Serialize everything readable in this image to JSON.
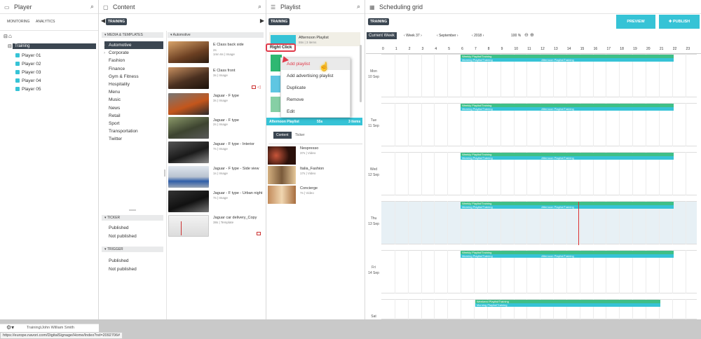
{
  "player_pane": {
    "title": "Player",
    "tabs": [
      "MONITORING",
      "ANALYTICS"
    ],
    "tree_root_icon": "home-icon",
    "group": "Training",
    "players": [
      "Player 01",
      "Player 02",
      "Player 03",
      "Player 04",
      "Player 05"
    ],
    "footer_user": "Training\\John William Smith",
    "status_url": "https://europe.navori.com/DigitalSignage/Home/Index?rel=2092706#"
  },
  "content_pane": {
    "title": "Content",
    "badge": "TRAINING",
    "media_header": "MEDIA & TEMPLATES",
    "categories": [
      "Automotive",
      "Corporate",
      "Fashion",
      "Finance",
      "Gym & Fitness",
      "Hospitality",
      "Menu",
      "Music",
      "News",
      "Retail",
      "Sport",
      "Transportation",
      "Twitter"
    ],
    "selected_category": "Automotive",
    "list_header": "Automotive",
    "items": [
      {
        "title": "E Class back side",
        "meta1": "2s",
        "meta2": "1mn 6s | Image",
        "color": "#7b5a3c"
      },
      {
        "title": "E Class front",
        "meta1": "3s | Image",
        "meta2": "",
        "color": "#6d4b2f"
      },
      {
        "title": "Jaguar - F type",
        "meta1": "3s | Image",
        "meta2": "",
        "color": "#4a4a4a"
      },
      {
        "title": "Jaguar - F type",
        "meta1": "2s | Image",
        "meta2": "",
        "color": "#556043"
      },
      {
        "title": "Jaguar - F type - Interior",
        "meta1": "7s | Image",
        "meta2": "",
        "color": "#2d2d2d"
      },
      {
        "title": "Jaguar - F type - Side view",
        "meta1": "1s | Image",
        "meta2": "",
        "color": "#9aa5b5"
      },
      {
        "title": "Jaguar - F type - Urban night",
        "meta1": "7s | Image",
        "meta2": "",
        "color": "#1e1e1e"
      },
      {
        "title": "Jaguar car delivery_Copy",
        "meta1": "38s | Template",
        "meta2": "",
        "color": "#e8e8e8"
      }
    ],
    "ticker_header": "TICKER",
    "ticker_items": [
      "Published",
      "Not published"
    ],
    "trigger_header": "TRIGGER",
    "trigger_items": [
      "Published",
      "Not published"
    ]
  },
  "playlist_pane": {
    "title": "Playlist",
    "badge": "TRAINING",
    "playlist_name": "Afternoon Playlist",
    "playlist_meta": "55s | 3 items",
    "playlist_colors": [
      "#36c3d6",
      "#2eb872",
      "#5fc6e2",
      "#86cfa5"
    ],
    "tooltip": "Right Click",
    "context_menu": [
      "Add playlist",
      "Add advertising playlist",
      "Duplicate",
      "Remove",
      "Edit"
    ],
    "selected_bar": {
      "name": "Afternoon Playlist",
      "duration": "55s",
      "count": "3 items"
    },
    "tabs": [
      "Content",
      "Ticker"
    ],
    "items": [
      {
        "title": "Nespresso",
        "meta": "37s | Video",
        "color": "#5a2a1e"
      },
      {
        "title": "Italia_Fashion",
        "meta": "17s | Video",
        "color": "#b99060"
      },
      {
        "title": "Concierge",
        "meta": "7s | Video",
        "color": "#c99a6b"
      }
    ]
  },
  "schedule_pane": {
    "title": "Scheduling grid",
    "preview_label": "PREVIEW",
    "publish_label": "PUBLISH",
    "badge": "TRAINING",
    "current_week_label": "Current Week",
    "week": "Week 37",
    "month": "September",
    "year": "2018",
    "zoom": "100 %",
    "hours": [
      "0",
      "1",
      "2",
      "3",
      "4",
      "5",
      "6",
      "7",
      "8",
      "9",
      "10",
      "11",
      "12",
      "13",
      "14",
      "15",
      "16",
      "17",
      "18",
      "19",
      "20",
      "21",
      "22",
      "23"
    ],
    "days": [
      {
        "day": "Mon",
        "date": "10 Sep"
      },
      {
        "day": "Tue",
        "date": "11 Sep"
      },
      {
        "day": "Wed",
        "date": "12 Sep"
      },
      {
        "day": "Thu",
        "date": "13 Sep"
      },
      {
        "day": "Fri",
        "date": "14 Sep"
      },
      {
        "day": "Sat",
        "date": ""
      }
    ],
    "bar_labels": {
      "weekly": "Weekly Playlist/Training",
      "morning": "Morning Playlist/Training",
      "afternoon": "Afternoon Playlist/Training",
      "weekend": "Weekend Playlist/Training"
    },
    "accent": "#36c3d6"
  }
}
